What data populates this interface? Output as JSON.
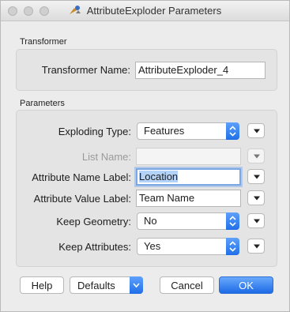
{
  "window": {
    "title": "AttributeExploder Parameters",
    "icon": "fme-transformer-icon"
  },
  "transformer_section": {
    "heading": "Transformer",
    "name_label": "Transformer Name:",
    "name_value": "AttributeExploder_4"
  },
  "parameters_section": {
    "heading": "Parameters",
    "exploding_type": {
      "label": "Exploding Type:",
      "value": "Features"
    },
    "list_name": {
      "label": "List Name:",
      "value": "",
      "disabled": true
    },
    "attribute_name_label": {
      "label": "Attribute Name Label:",
      "value": "Location"
    },
    "attribute_value_label": {
      "label": "Attribute Value Label:",
      "value": "Team Name"
    },
    "keep_geometry": {
      "label": "Keep Geometry:",
      "value": "No"
    },
    "keep_attributes": {
      "label": "Keep Attributes:",
      "value": "Yes"
    }
  },
  "buttons": {
    "help": "Help",
    "defaults": "Defaults",
    "cancel": "Cancel",
    "ok": "OK"
  },
  "colors": {
    "accent": "#1f6fe8",
    "focus_ring": "#7aa7e8",
    "selection": "#b3d3f8"
  }
}
